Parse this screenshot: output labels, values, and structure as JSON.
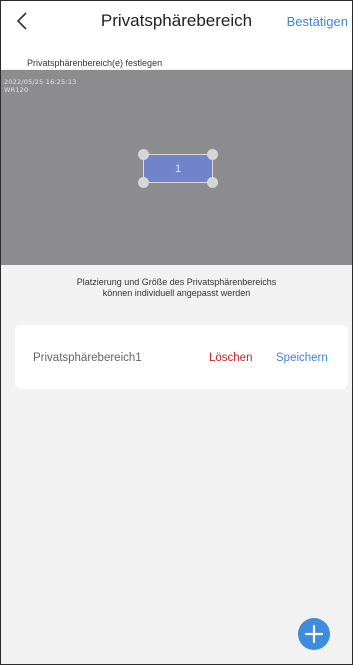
{
  "header": {
    "title": "Privatsphärebereich",
    "confirm_label": "Bestätigen",
    "back_icon": "chevron-left-icon"
  },
  "subheader": {
    "label": "Privatsphärenbereich(e) festlegen"
  },
  "preview": {
    "osd_datetime": "2022/05/25  16:25:13",
    "osd_camera": "WR120",
    "zones": [
      {
        "label": "1"
      }
    ]
  },
  "hint": {
    "line1": "Platzierung und Größe des Privatsphärenbereichs",
    "line2": "können individuell angepasst werden"
  },
  "zone_list": [
    {
      "name": "Privatsphärebereich1",
      "delete_label": "Löschen",
      "save_label": "Speichern"
    }
  ],
  "fab": {
    "icon": "plus-icon"
  },
  "colors": {
    "accent": "#3b86d6",
    "danger": "#cc2222",
    "zone_fill": "#7183c9",
    "preview_bg": "#8c8c8f",
    "page_bg": "#f2f2f2"
  }
}
